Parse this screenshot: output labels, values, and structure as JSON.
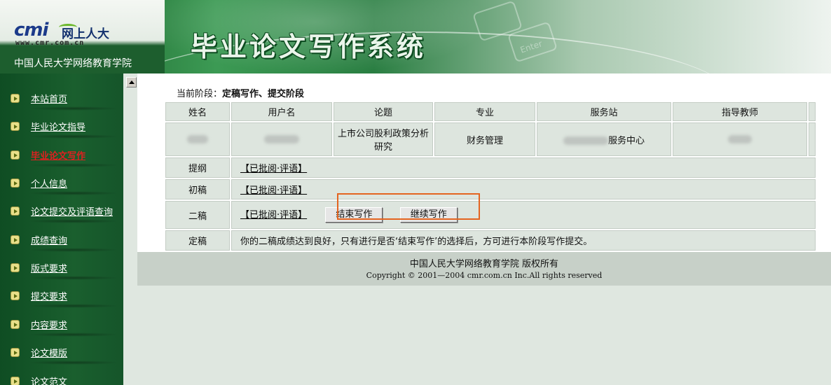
{
  "header": {
    "logo_mark": "cmi",
    "logo_cn": "网上人大",
    "logo_url": "www.cmr.com.cn",
    "school": "中国人民大学网络教育学院",
    "title": "毕业论文写作系统"
  },
  "sidebar": {
    "items": [
      {
        "label": "本站首页",
        "active": false
      },
      {
        "label": "毕业论文指导",
        "active": false
      },
      {
        "label": "毕业论文写作",
        "active": true
      },
      {
        "label": "个人信息",
        "active": false
      },
      {
        "label": "论文提交及评语查询",
        "active": false
      },
      {
        "label": "成绩查询",
        "active": false
      },
      {
        "label": "版式要求",
        "active": false
      },
      {
        "label": "提交要求",
        "active": false
      },
      {
        "label": "内容要求",
        "active": false
      },
      {
        "label": "论文模版",
        "active": false
      },
      {
        "label": "论文范文",
        "active": false
      }
    ]
  },
  "main": {
    "stage_label": "当前阶段：",
    "stage_value": "定稿写作、提交阶段",
    "columns": [
      "姓名",
      "用户名",
      "论题",
      "专业",
      "服务站",
      "指导教师"
    ],
    "info": {
      "topic": "上市公司股利政策分析研究",
      "major": "财务管理",
      "station_suffix": "服务中心"
    },
    "rows": [
      {
        "label": "提纲",
        "review": "【已批阅·评语】"
      },
      {
        "label": "初稿",
        "review": "【已批阅·评语】"
      },
      {
        "label": "二稿",
        "review": "【已批阅·评语】"
      },
      {
        "label": "定稿",
        "note": "你的二稿成绩达到良好，只有进行是否‘结束写作’的选择后，方可进行本阶段写作提交。"
      }
    ],
    "buttons": {
      "end": "结束写作",
      "continue": "继续写作"
    }
  },
  "footer": {
    "line1": "中国人民大学网络教育学院 版权所有",
    "line2": "Copyright © 2001—2004 cmr.com.cn Inc.All rights reserved"
  },
  "colors": {
    "accent_border": "#e46420",
    "active_nav": "#e02020",
    "sidebar": "#1a5f2e"
  }
}
